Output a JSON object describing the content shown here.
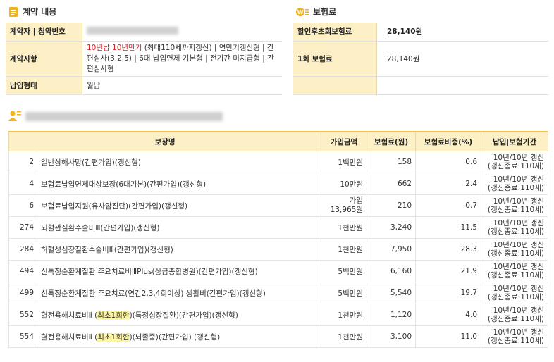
{
  "contract": {
    "title": "계약 내용",
    "rows": {
      "holder_label": "계약자  |  청약번호",
      "details_label": "계약사항",
      "details_highlight": "10년납 10년만기",
      "details_text": " (최대110세까지갱신)  |  연만기갱신형 | 간편심사(3.2.5) | 6대 납입면제 기본형 | 전기간 미지급형 | 간편심사형",
      "payment_label": "납입형태",
      "payment_value": "월납"
    }
  },
  "premium": {
    "title": "보험료",
    "discounted_label": "할인후초회보험료",
    "discounted_value": "28,140원",
    "first_label": "1회 보험료",
    "first_value": "28,140원"
  },
  "coverage": {
    "headers": [
      "보장명",
      "가입금액",
      "보험료(원)",
      "보험료비중(%)",
      "납입|보험기간"
    ],
    "rows": [
      {
        "code": "2",
        "name": "일반상해사망(간편가입)(갱신형)",
        "amount": "1백만원",
        "premium": "158",
        "ratio": "0.6",
        "period1": "10년/10년 갱신",
        "period2": "(갱신종료:110세)"
      },
      {
        "code": "4",
        "name": "보험료납입면제대상보장(6대기본)(간편가입)(갱신형)",
        "amount": "10만원",
        "premium": "662",
        "ratio": "2.4",
        "period1": "10년/10년 갱신",
        "period2": "(갱신종료:110세)"
      },
      {
        "code": "6",
        "name": "보험료납입지원(유사암진단)(간편가입)(갱신형)",
        "amount": "가입13,965원",
        "premium": "210",
        "ratio": "0.7",
        "period1": "10년/10년 갱신",
        "period2": "(갱신종료:110세)"
      },
      {
        "code": "274",
        "name": "뇌혈관질환수술비Ⅲ(간편가입)(갱신형)",
        "amount": "1천만원",
        "premium": "3,240",
        "ratio": "11.5",
        "period1": "10년/10년 갱신",
        "period2": "(갱신종료:110세)"
      },
      {
        "code": "284",
        "name": "허혈성심장질환수술비Ⅲ(간편가입)(갱신형)",
        "amount": "1천만원",
        "premium": "7,950",
        "ratio": "28.3",
        "period1": "10년/10년 갱신",
        "period2": "(갱신종료:110세)"
      },
      {
        "code": "494",
        "name": "신특정순환계질환 주요치료비ⅢPlus(상급종합병원)(간편가입)(갱신형)",
        "amount": "5백만원",
        "premium": "6,160",
        "ratio": "21.9",
        "period1": "10년/10년 갱신",
        "period2": "(갱신종료:110세)"
      },
      {
        "code": "499",
        "name": "신특정순환계질환 주요치료(연간2,3,4회이상) 생활비(간편가입)(갱신형)",
        "amount": "5백만원",
        "premium": "5,540",
        "ratio": "19.7",
        "period1": "10년/10년 갱신",
        "period2": "(갱신종료:110세)"
      },
      {
        "code": "552",
        "name_pre": "혈전용해치료비Ⅱ (",
        "name_hl": "최초1회한",
        "name_post": ")(특정심장질환)(간편가입)(갱신형)",
        "amount": "1천만원",
        "premium": "1,120",
        "ratio": "4.0",
        "period1": "10년/10년 갱신",
        "period2": "(갱신종료:110세)"
      },
      {
        "code": "554",
        "name_pre": "혈전용해치료비Ⅱ (",
        "name_hl": "최초1회한",
        "name_post": ")(뇌졸중)(간편가입) (갱신형)",
        "amount": "1천만원",
        "premium": "3,100",
        "ratio": "11.0",
        "period1": "10년/10년 갱신",
        "period2": "(갱신종료:110세)"
      }
    ]
  },
  "colors": {
    "header_bg": "#fdf0c7",
    "accent": "#f3c542",
    "highlight": "#fff6a0",
    "red": "#e02020"
  }
}
